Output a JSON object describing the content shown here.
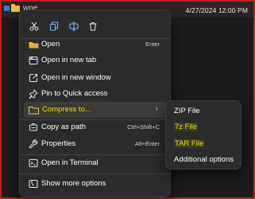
{
  "taskbar": {
    "filename": "wpe",
    "datetime": "4/27/2024 12:00 PM"
  },
  "quick_actions": {
    "cut": "scissors-icon",
    "copy": "copy-icon",
    "rename": "rename-icon",
    "delete": "trash-icon"
  },
  "menu": {
    "open": {
      "label": "Open",
      "shortcut": "Enter"
    },
    "open_new_tab": {
      "label": "Open in new tab"
    },
    "open_new_window": {
      "label": "Open in new window"
    },
    "pin_quick_access": {
      "label": "Pin to Quick access"
    },
    "compress_to": {
      "label": "Compress to..."
    },
    "copy_as_path": {
      "label": "Copy as path",
      "shortcut": "Ctrl+Shift+C"
    },
    "properties": {
      "label": "Properties",
      "shortcut": "Alt+Enter"
    },
    "open_terminal": {
      "label": "Open in Terminal"
    },
    "show_more": {
      "label": "Show more options"
    }
  },
  "submenu": {
    "zip": "ZIP File",
    "sevenz": "7z File",
    "tar": "TAR File",
    "additional": "Additional options"
  },
  "colors": {
    "highlight_text": "#f2e100",
    "border_frame": "#c8181e",
    "menu_bg": "#2b2b2b"
  }
}
